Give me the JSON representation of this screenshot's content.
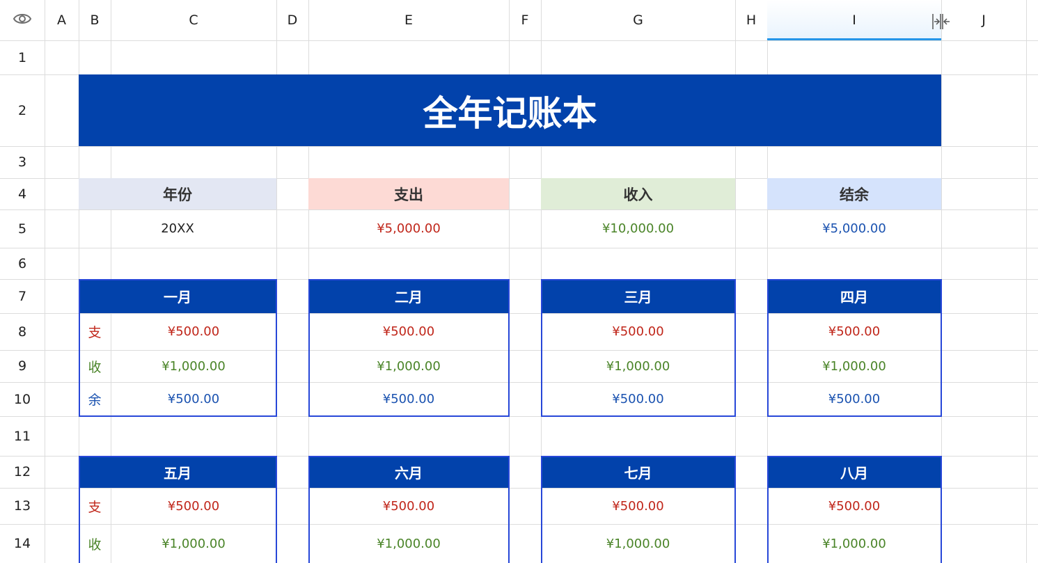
{
  "columns": [
    "A",
    "B",
    "C",
    "D",
    "E",
    "F",
    "G",
    "H",
    "I",
    "J"
  ],
  "selected_column": "I",
  "rows": [
    "1",
    "2",
    "3",
    "4",
    "5",
    "6",
    "7",
    "8",
    "9",
    "10",
    "11",
    "12",
    "13",
    "14"
  ],
  "icons": {
    "header_corner": "eye-icon",
    "column_resize": "column-resize-icon"
  },
  "colors": {
    "brand_blue": "#0242ab",
    "expense": "#c0261a",
    "income": "#4a8428",
    "balance": "#1a52b0",
    "year_header_bg": "#e3e7f3",
    "expense_header_bg": "#fddad5",
    "income_header_bg": "#e0edd7",
    "balance_header_bg": "#d5e3fc"
  },
  "sheet": {
    "title": "全年记账本",
    "summary": {
      "year": {
        "label": "年份",
        "value": "20XX"
      },
      "expense": {
        "label": "支出",
        "value": "¥5,000.00"
      },
      "income": {
        "label": "收入",
        "value": "¥10,000.00"
      },
      "balance": {
        "label": "结余",
        "value": "¥5,000.00"
      }
    },
    "labels": {
      "expense": "支",
      "income": "收",
      "balance": "余"
    },
    "months": [
      {
        "name": "一月",
        "expense": "¥500.00",
        "income": "¥1,000.00",
        "balance": "¥500.00"
      },
      {
        "name": "二月",
        "expense": "¥500.00",
        "income": "¥1,000.00",
        "balance": "¥500.00"
      },
      {
        "name": "三月",
        "expense": "¥500.00",
        "income": "¥1,000.00",
        "balance": "¥500.00"
      },
      {
        "name": "四月",
        "expense": "¥500.00",
        "income": "¥1,000.00",
        "balance": "¥500.00"
      },
      {
        "name": "五月",
        "expense": "¥500.00",
        "income": "¥1,000.00"
      },
      {
        "name": "六月",
        "expense": "¥500.00",
        "income": "¥1,000.00"
      },
      {
        "name": "七月",
        "expense": "¥500.00",
        "income": "¥1,000.00"
      },
      {
        "name": "八月",
        "expense": "¥500.00",
        "income": "¥1,000.00"
      }
    ]
  }
}
